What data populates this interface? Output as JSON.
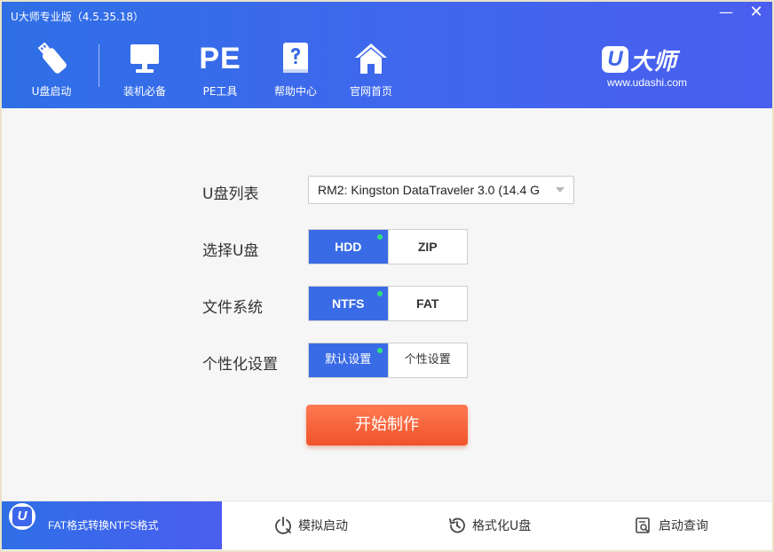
{
  "window": {
    "title": "U大师专业版（4.5.35.18）",
    "minimize_glyph": "—",
    "close_glyph": "✕"
  },
  "nav": [
    {
      "label": "U盘启动",
      "icon": "usb-drive-icon"
    },
    {
      "label": "装机必备",
      "icon": "monitor-icon"
    },
    {
      "label": "PE工具",
      "icon": "pe-icon",
      "icon_text": "PE"
    },
    {
      "label": "帮助中心",
      "icon": "help-book-icon"
    },
    {
      "label": "官网首页",
      "icon": "home-icon"
    }
  ],
  "logo": {
    "mark": "U",
    "name": "大师",
    "url": "www.udashi.com"
  },
  "form": {
    "usb_list": {
      "label": "U盘列表",
      "value": "RM2: Kingston DataTraveler 3.0 (14.4 G"
    },
    "select_usb": {
      "label": "选择U盘",
      "options": [
        "HDD",
        "ZIP"
      ],
      "selected": "HDD"
    },
    "file_system": {
      "label": "文件系统",
      "options": [
        "NTFS",
        "FAT"
      ],
      "selected": "NTFS"
    },
    "personalize": {
      "label": "个性化设置",
      "options": [
        "默认设置",
        "个性设置"
      ],
      "selected": "默认设置"
    },
    "start_button": "开始制作"
  },
  "footer": {
    "badge": "U",
    "active_tab": "FAT格式转换NTFS格式",
    "items": [
      {
        "label": "模拟启动",
        "icon": "power-icon"
      },
      {
        "label": "格式化U盘",
        "icon": "history-icon"
      },
      {
        "label": "启动查询",
        "icon": "search-doc-icon"
      }
    ]
  },
  "colors": {
    "header_blue": "#3a6be6",
    "active_option": "#3a6be6",
    "start_button": "#f25a30",
    "indicator_dot": "#2ee27a"
  }
}
